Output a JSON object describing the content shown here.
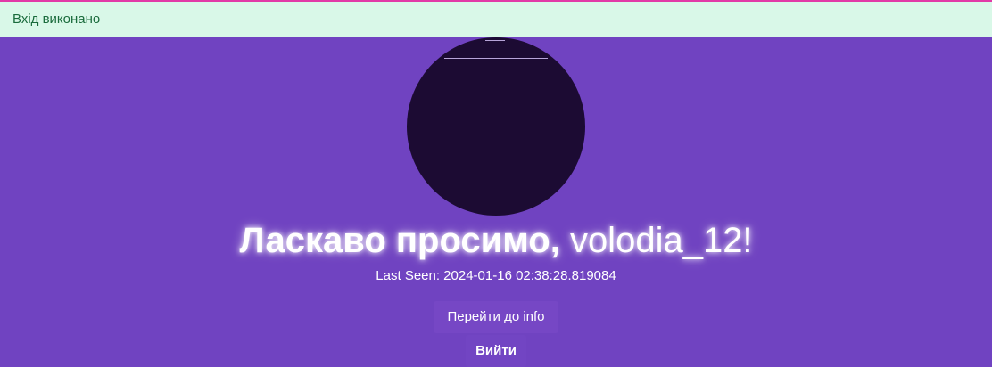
{
  "alert": {
    "text": "Вхід виконано"
  },
  "welcome": {
    "greeting": "Ласкаво просимо,",
    "username": "volodia_12!"
  },
  "last_seen": {
    "text": "Last Seen: 2024-01-16 02:38:28.819084"
  },
  "buttons": {
    "info_label": "Перейти до info",
    "logout_label": "Вийти"
  },
  "colors": {
    "background": "#7043c1",
    "alert_bg": "#d9f8e8",
    "alert_text": "#1a6b3c",
    "top_accent": "#e23aa7",
    "avatar": "#1c0b33"
  }
}
